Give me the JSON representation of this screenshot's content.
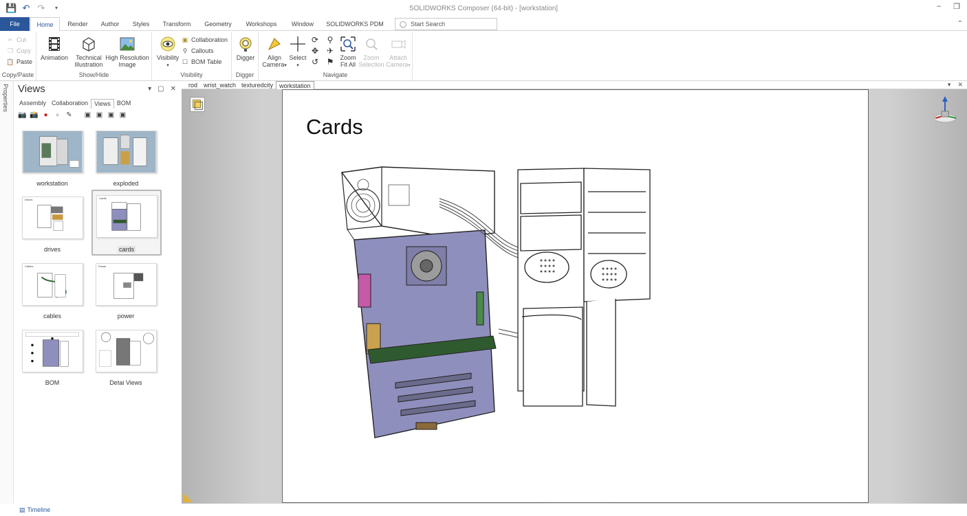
{
  "window": {
    "title": "SOLIDWORKS Composer (64-bit) - [workstation]",
    "quick_access": [
      "save-icon",
      "undo-icon",
      "redo-icon",
      "customize-icon"
    ]
  },
  "ribbon_tabs": [
    {
      "label": "File"
    },
    {
      "label": "Home"
    },
    {
      "label": "Render"
    },
    {
      "label": "Author"
    },
    {
      "label": "Styles"
    },
    {
      "label": "Transform"
    },
    {
      "label": "Geometry"
    },
    {
      "label": "Workshops"
    },
    {
      "label": "Window"
    },
    {
      "label": "SOLIDWORKS PDM"
    }
  ],
  "search": {
    "placeholder": "Start Search"
  },
  "ribbon": {
    "copy_paste": {
      "label": "Copy/Paste",
      "cut": "Cut",
      "copy": "Copy",
      "paste": "Paste"
    },
    "show_hide": {
      "label": "Show/Hide",
      "animation": "Animation",
      "technical_line1": "Technical",
      "technical_line2": "Illustration",
      "highres_line1": "High Resolution",
      "highres_line2": "Image"
    },
    "visibility": {
      "label": "Visibility",
      "visibility_btn": "Visibility",
      "collaboration": "Collaboration",
      "callouts": "Callouts",
      "bom_table": "BOM Table"
    },
    "digger": {
      "label": "Digger",
      "digger_btn": "Digger"
    },
    "navigate": {
      "label": "Navigate",
      "align_line1": "Align",
      "align_line2": "Camera",
      "select": "Select",
      "zoomfit_line1": "Zoom",
      "zoomfit_line2": "Fit All",
      "zoomsel_line1": "Zoom",
      "zoomsel_line2": "Selection",
      "attach_line1": "Attach",
      "attach_line2": "Camera"
    }
  },
  "properties_tab": "Properties",
  "views_panel": {
    "title": "Views",
    "tabs": [
      "Assembly",
      "Collaboration",
      "Views",
      "BOM"
    ],
    "active_tab": "Views",
    "thumbnails": [
      {
        "caption": "workstation"
      },
      {
        "caption": "exploded"
      },
      {
        "caption": "drives",
        "label": "Drives"
      },
      {
        "caption": "cards",
        "label": "Cards"
      },
      {
        "caption": "cables",
        "label": "Cables"
      },
      {
        "caption": "power",
        "label": "Power"
      },
      {
        "caption": "BOM"
      },
      {
        "caption": "Detai Views"
      }
    ],
    "selected": "cards"
  },
  "timeline": "Timeline",
  "doc_tabs": [
    "rod",
    "wrist_watch",
    "texturedcity",
    "workstation"
  ],
  "active_doc": "workstation",
  "viewport": {
    "sheet_title": "Cards"
  },
  "colors": {
    "file_tab": "#2a579a",
    "accent": "#2a579a",
    "board": "#8f8fbe"
  }
}
